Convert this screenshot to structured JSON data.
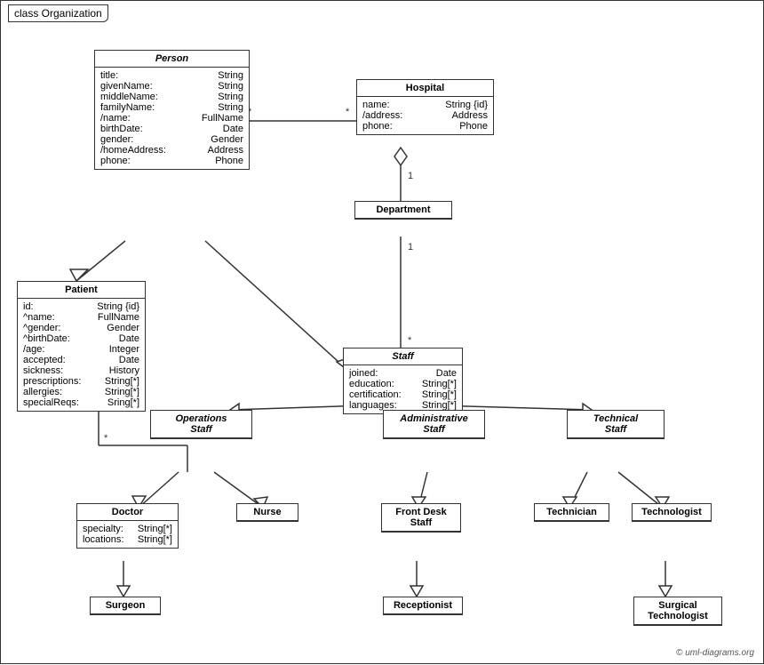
{
  "diagram": {
    "title": "class Organization",
    "copyright": "© uml-diagrams.org",
    "classes": {
      "person": {
        "title": "Person",
        "italic": true,
        "attrs": [
          [
            "title:",
            "String"
          ],
          [
            "givenName:",
            "String"
          ],
          [
            "middleName:",
            "String"
          ],
          [
            "familyName:",
            "String"
          ],
          [
            "/name:",
            "FullName"
          ],
          [
            "birthDate:",
            "Date"
          ],
          [
            "gender:",
            "Gender"
          ],
          [
            "/homeAddress:",
            "Address"
          ],
          [
            "phone:",
            "Phone"
          ]
        ]
      },
      "hospital": {
        "title": "Hospital",
        "italic": false,
        "attrs": [
          [
            "name:",
            "String {id}"
          ],
          [
            "/address:",
            "Address"
          ],
          [
            "phone:",
            "Phone"
          ]
        ]
      },
      "department": {
        "title": "Department",
        "italic": false,
        "attrs": []
      },
      "staff": {
        "title": "Staff",
        "italic": true,
        "attrs": [
          [
            "joined:",
            "Date"
          ],
          [
            "education:",
            "String[*]"
          ],
          [
            "certification:",
            "String[*]"
          ],
          [
            "languages:",
            "String[*]"
          ]
        ]
      },
      "patient": {
        "title": "Patient",
        "italic": false,
        "attrs": [
          [
            "id:",
            "String {id}"
          ],
          [
            "^name:",
            "FullName"
          ],
          [
            "^gender:",
            "Gender"
          ],
          [
            "^birthDate:",
            "Date"
          ],
          [
            "/age:",
            "Integer"
          ],
          [
            "accepted:",
            "Date"
          ],
          [
            "sickness:",
            "History"
          ],
          [
            "prescriptions:",
            "String[*]"
          ],
          [
            "allergies:",
            "String[*]"
          ],
          [
            "specialReqs:",
            "Sring[*]"
          ]
        ]
      },
      "operations_staff": {
        "title": "Operations Staff",
        "italic": true,
        "attrs": []
      },
      "administrative_staff": {
        "title": "Administrative Staff",
        "italic": true,
        "attrs": []
      },
      "technical_staff": {
        "title": "Technical Staff",
        "italic": true,
        "attrs": []
      },
      "doctor": {
        "title": "Doctor",
        "italic": false,
        "attrs": [
          [
            "specialty:",
            "String[*]"
          ],
          [
            "locations:",
            "String[*]"
          ]
        ]
      },
      "nurse": {
        "title": "Nurse",
        "italic": false,
        "attrs": []
      },
      "front_desk_staff": {
        "title": "Front Desk Staff",
        "italic": false,
        "attrs": []
      },
      "technician": {
        "title": "Technician",
        "italic": false,
        "attrs": []
      },
      "technologist": {
        "title": "Technologist",
        "italic": false,
        "attrs": []
      },
      "surgeon": {
        "title": "Surgeon",
        "italic": false,
        "attrs": []
      },
      "receptionist": {
        "title": "Receptionist",
        "italic": false,
        "attrs": []
      },
      "surgical_technologist": {
        "title": "Surgical Technologist",
        "italic": false,
        "attrs": []
      }
    }
  }
}
